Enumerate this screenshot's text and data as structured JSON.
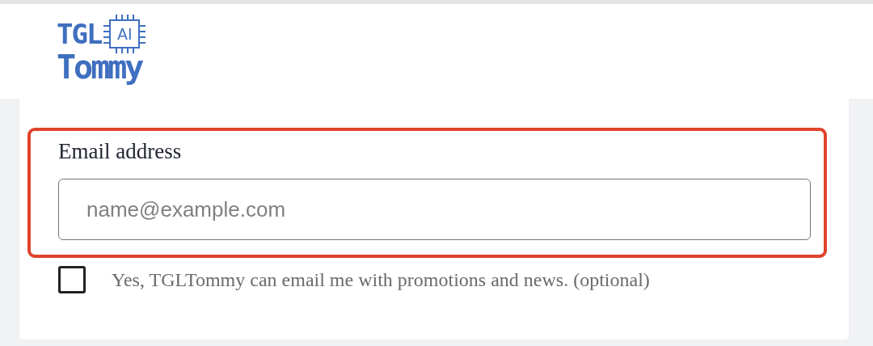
{
  "logo": {
    "prefix": "TGL",
    "chip_text": "AI",
    "name": "Tommy"
  },
  "email_field": {
    "label": "Email address",
    "placeholder": "name@example.com",
    "highlighted": true
  },
  "consent": {
    "label": "Yes, TGLTommy can email me with promotions and news. (optional)",
    "checked": false
  }
}
